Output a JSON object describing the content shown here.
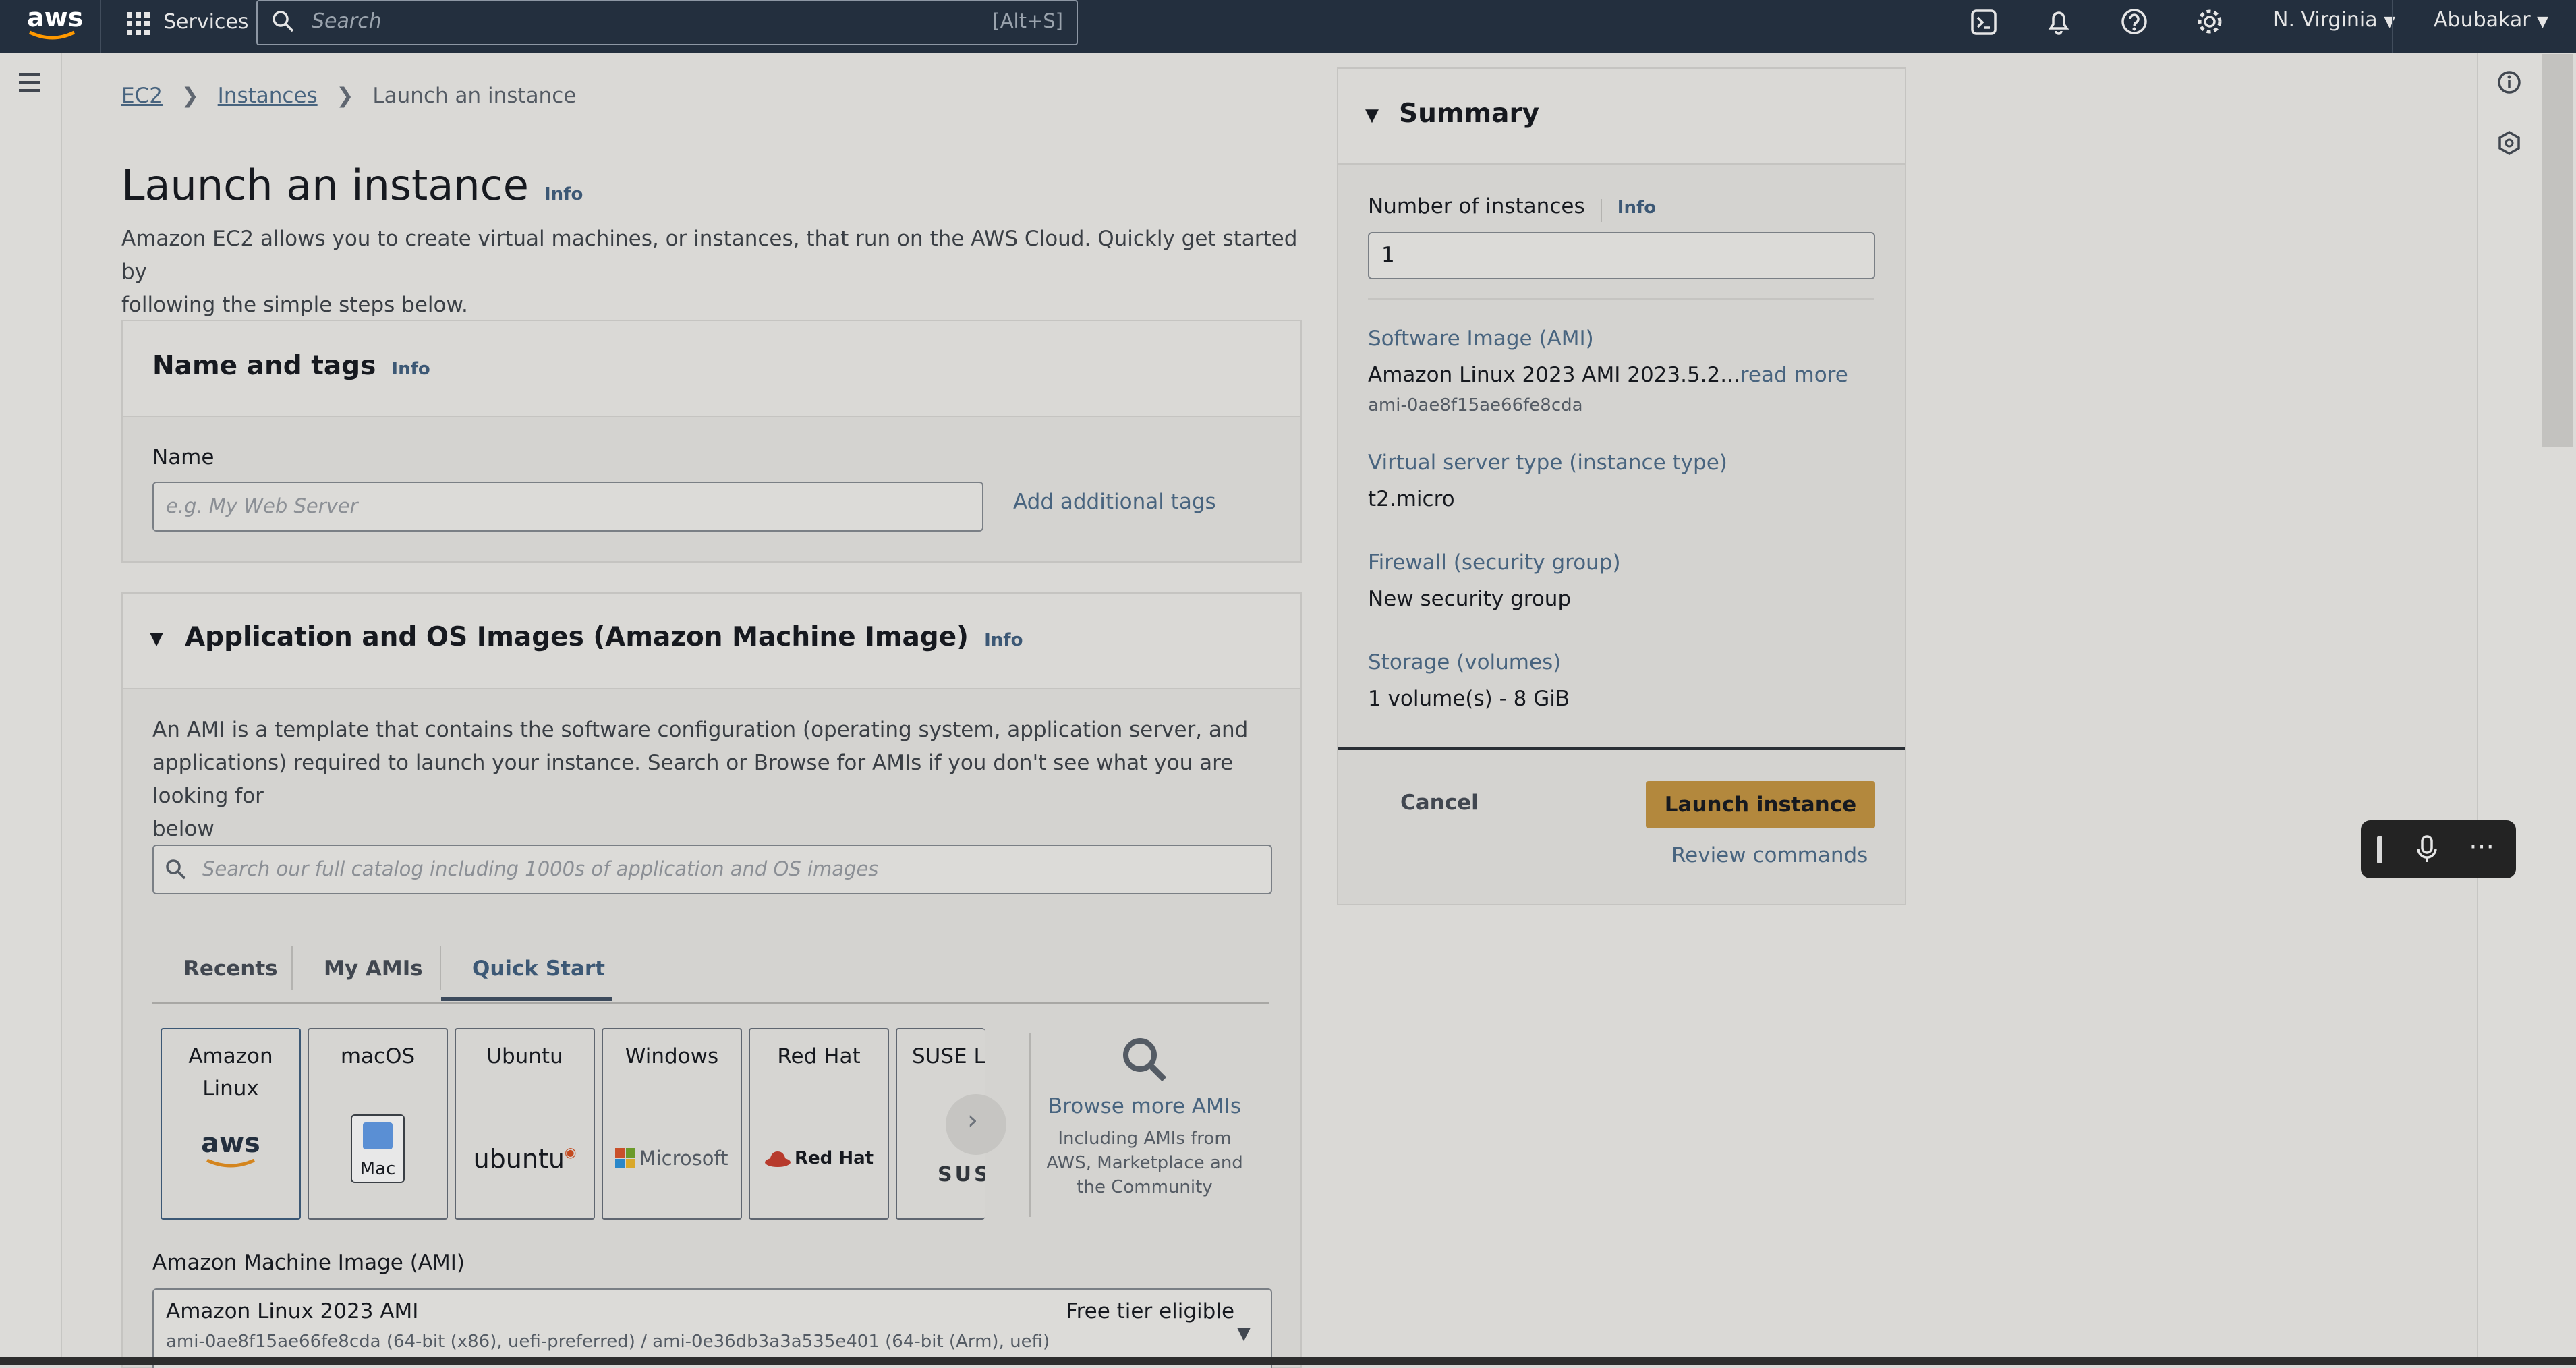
{
  "topbar": {
    "logo": "aws",
    "services_label": "Services",
    "search_placeholder": "Search",
    "search_shortcut": "[Alt+S]",
    "region": "N. Virginia",
    "user": "Abubakar"
  },
  "breadcrumb": [
    "EC2",
    "Instances",
    "Launch an instance"
  ],
  "page": {
    "title": "Launch an instance",
    "info": "Info",
    "description_line1": "Amazon EC2 allows you to create virtual machines, or instances, that run on the AWS Cloud. Quickly get started by",
    "description_line2": "following the simple steps below."
  },
  "name_tags": {
    "heading": "Name and tags",
    "info": "Info",
    "name_label": "Name",
    "name_placeholder": "e.g. My Web Server",
    "name_value": "",
    "add_tags": "Add additional tags"
  },
  "ami_section": {
    "heading": "Application and OS Images (Amazon Machine Image)",
    "info": "Info",
    "desc_line1": "An AMI is a template that contains the software configuration (operating system, application server, and",
    "desc_line2": "applications) required to launch your instance. Search or Browse for AMIs if you don't see what you are looking for",
    "desc_line3": "below",
    "search_placeholder": "Search our full catalog including 1000s of application and OS images",
    "tabs": [
      "Recents",
      "My AMIs",
      "Quick Start"
    ],
    "active_tab": "Quick Start",
    "cards": [
      {
        "title1": "Amazon",
        "title2": "Linux",
        "logo": "aws"
      },
      {
        "title1": "macOS",
        "title2": "",
        "logo": "Mac"
      },
      {
        "title1": "Ubuntu",
        "title2": "",
        "logo": "ubuntu"
      },
      {
        "title1": "Windows",
        "title2": "",
        "logo": "Microsoft"
      },
      {
        "title1": "Red Hat",
        "title2": "",
        "logo": "Red Hat"
      },
      {
        "title1": "SUSE Li",
        "title2": "",
        "logo": "SUS"
      }
    ],
    "browse_title": "Browse more AMIs",
    "browse_desc1": "Including AMIs from",
    "browse_desc2": "AWS, Marketplace and",
    "browse_desc3": "the Community",
    "ami_label": "Amazon Machine Image (AMI)",
    "ami_selected_name": "Amazon Linux 2023 AMI",
    "ami_selected_badge": "Free tier eligible",
    "ami_selected_ids": "ami-0ae8f15ae66fe8cda (64-bit (x86), uefi-preferred) / ami-0e36db3a3a535e401 (64-bit (Arm), uefi)"
  },
  "summary": {
    "heading": "Summary",
    "num_label": "Number of instances",
    "info": "Info",
    "num_value": "1",
    "ami_label": "Software Image (AMI)",
    "ami_value": "Amazon Linux 2023 AMI 2023.5.2...",
    "read_more": "read more",
    "ami_id": "ami-0ae8f15ae66fe8cda",
    "type_label": "Virtual server type (instance type)",
    "type_value": "t2.micro",
    "fw_label": "Firewall (security group)",
    "fw_value": "New security group",
    "storage_label": "Storage (volumes)",
    "storage_value": "1 volume(s) - 8 GiB",
    "cancel": "Cancel",
    "launch": "Launch instance",
    "review": "Review commands"
  },
  "colors": {
    "topbar": "#232f3e",
    "launch_button": "#b3883d",
    "link": "#48647f"
  }
}
